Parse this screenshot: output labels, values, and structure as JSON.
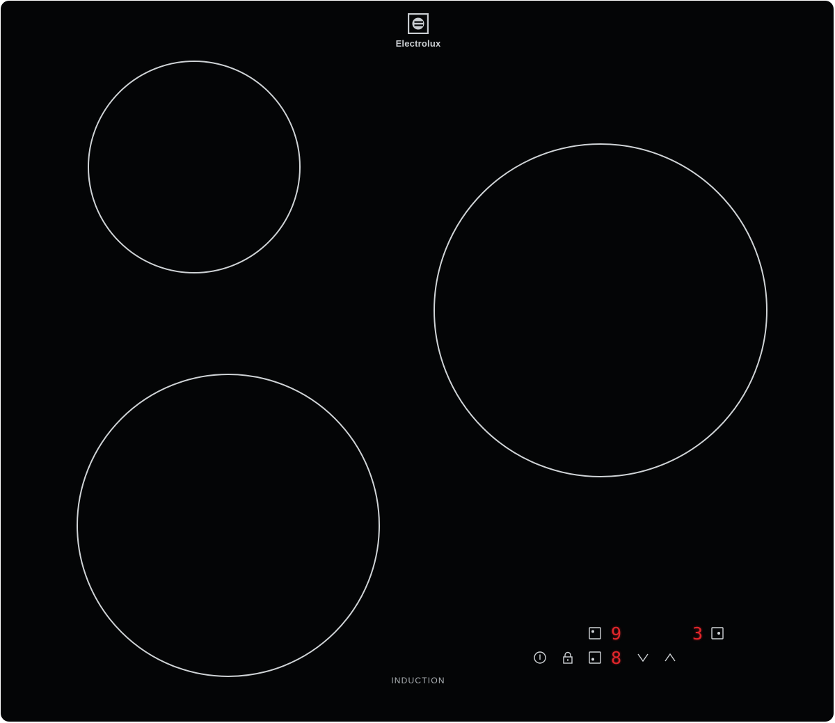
{
  "brand": {
    "name": "Electrolux",
    "logo_icon": "electrolux-logo-icon"
  },
  "hob": {
    "type_label": "INDUCTION",
    "surface_color": "#040506",
    "ring_color": "#cfd3d6",
    "display_color": "#e3262b"
  },
  "cooking_zones": [
    {
      "name": "top-left"
    },
    {
      "name": "right"
    },
    {
      "name": "bottom-left"
    }
  ],
  "control_panel": {
    "power_icon": "power-icon",
    "lock_icon": "lock-icon",
    "decrease_icon": "chevron-down-icon",
    "increase_icon": "chevron-up-icon",
    "zone_selectors": [
      {
        "zone": "rear-left",
        "icon": "zone-rear-left-icon",
        "level": "9"
      },
      {
        "zone": "front-left",
        "icon": "zone-front-left-icon",
        "level": "8"
      },
      {
        "zone": "right",
        "icon": "zone-right-icon",
        "level": "3"
      }
    ]
  }
}
